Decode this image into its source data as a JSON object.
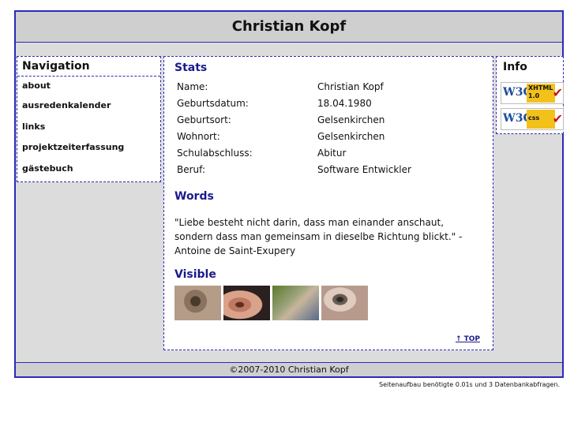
{
  "header": {
    "title": "Christian Kopf"
  },
  "navigation": {
    "heading": "Navigation",
    "items": [
      "about",
      "ausredenkalender",
      "links",
      "projektzeiterfassung",
      "gästebuch"
    ]
  },
  "stats": {
    "heading": "Stats",
    "rows": [
      {
        "key": "Name:",
        "value": "Christian Kopf"
      },
      {
        "key": "Geburtsdatum:",
        "value": "18.04.1980"
      },
      {
        "key": "Geburtsort:",
        "value": "Gelsenkirchen"
      },
      {
        "key": "Wohnort:",
        "value": "Gelsenkirchen"
      },
      {
        "key": "Schulabschluss:",
        "value": "Abitur"
      },
      {
        "key": "Beruf:",
        "value": "Software Entwickler"
      }
    ]
  },
  "words": {
    "heading": "Words",
    "quote": "\"Liebe besteht nicht darin, dass man einander anschaut, sondern dass man gemeinsam in dieselbe Richtung blickt.\" - Antoine de Saint-Exupery"
  },
  "visible": {
    "heading": "Visible",
    "thumbnails": [
      "eye-photo",
      "ear-photo",
      "hand-photo",
      "eye-closeup-photo"
    ]
  },
  "top_link": "↑ TOP",
  "info": {
    "heading": "Info",
    "badges": [
      {
        "w3c": "W3C",
        "label_line1": "XHTML",
        "label_line2": "1.0",
        "icon": "check-icon"
      },
      {
        "w3c": "W3C",
        "label_line1": "css",
        "label_line2": "",
        "icon": "check-icon"
      }
    ]
  },
  "footer": {
    "copyright": "©2007-2010 Christian Kopf"
  },
  "status": "Seitenaufbau benötigte 0.01s und 3 Datenbankabfragen."
}
